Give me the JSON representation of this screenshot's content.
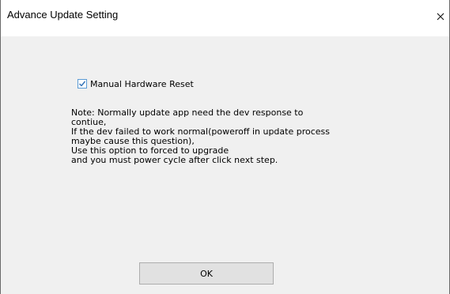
{
  "window": {
    "title": "Advance Update Setting",
    "close_glyph": "×"
  },
  "option": {
    "label": "Manual Hardware Reset",
    "checked": true
  },
  "note": {
    "lines": [
      "Note: Normally update app need the dev response to",
      "contiue,",
      "If the dev failed to work normal(poweroff in update process",
      "maybe cause this question),",
      "Use this option to forced to upgrade",
      "and you must power cycle after click next step."
    ]
  },
  "buttons": {
    "ok_label": "OK"
  },
  "colors": {
    "client_background": "#f0f0f0",
    "checkbox_border": "#5b9bd5",
    "checkmark": "#2f6fb5",
    "button_face": "#e1e1e1",
    "button_border": "#adadad"
  },
  "icons": {
    "close": "close-icon",
    "checkmark": "checkmark-icon"
  }
}
